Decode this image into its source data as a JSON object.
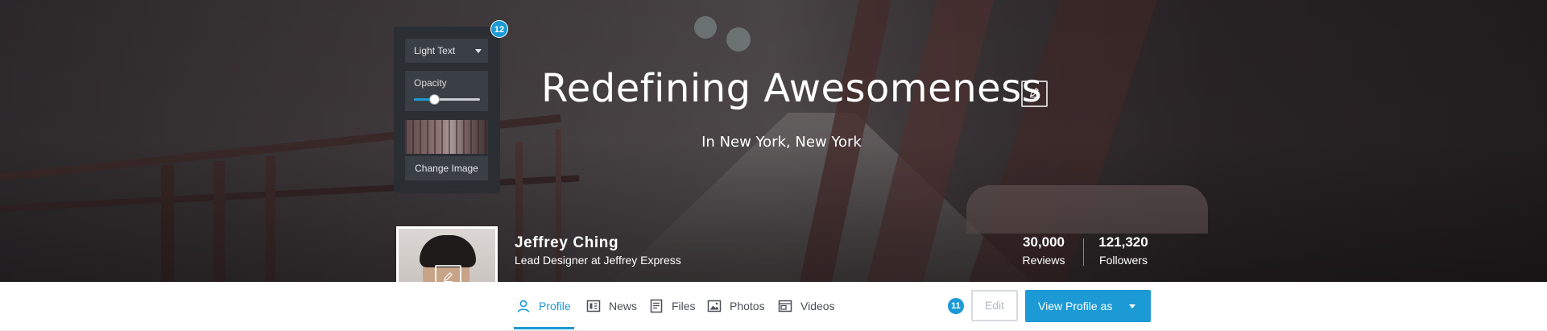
{
  "header": {
    "title": "Redefining Awesomeness",
    "subtitle": "In New York, New York"
  },
  "editor_panel": {
    "badge": "12",
    "text_style": "Light Text",
    "opacity_label": "Opacity",
    "opacity_value": 0.3,
    "change_image_label": "Change Image"
  },
  "profile": {
    "name": "Jeffrey Ching",
    "role": "Lead Designer at Jeffrey Express",
    "stats": [
      {
        "value": "30,000",
        "label": "Reviews"
      },
      {
        "value": "121,320",
        "label": "Followers"
      }
    ]
  },
  "nav": {
    "tabs": [
      {
        "label": "Profile",
        "icon": "user-icon",
        "active": true
      },
      {
        "label": "News",
        "icon": "news-icon",
        "active": false
      },
      {
        "label": "Files",
        "icon": "file-icon",
        "active": false
      },
      {
        "label": "Photos",
        "icon": "image-icon",
        "active": false
      },
      {
        "label": "Videos",
        "icon": "video-icon",
        "active": false
      }
    ],
    "badge": "11",
    "edit_label": "Edit",
    "view_profile_label": "View Profile as"
  },
  "colors": {
    "accent": "#1b9ad6",
    "panel": "#2a2e33",
    "panel_control": "#3a3f45"
  }
}
